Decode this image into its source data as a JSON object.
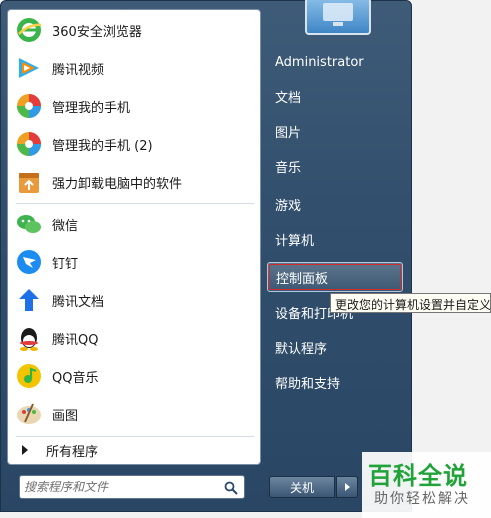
{
  "start_menu": {
    "pinned_apps": [
      {
        "label": "360安全浏览器",
        "icon": "360-browser-icon"
      },
      {
        "label": "腾讯视频",
        "icon": "tencent-video-icon"
      },
      {
        "label": "管理我的手机",
        "icon": "phone-manager-icon"
      },
      {
        "label": "管理我的手机 (2)",
        "icon": "phone-manager-icon"
      },
      {
        "label": "强力卸载电脑中的软件",
        "icon": "uninstaller-icon"
      },
      {
        "label": "微信",
        "icon": "wechat-icon"
      },
      {
        "label": "钉钉",
        "icon": "dingtalk-icon"
      },
      {
        "label": "腾讯文档",
        "icon": "tencent-docs-icon"
      },
      {
        "label": "腾讯QQ",
        "icon": "qq-icon"
      },
      {
        "label": "QQ音乐",
        "icon": "qq-music-icon"
      },
      {
        "label": "画图",
        "icon": "paint-icon"
      }
    ],
    "all_programs": "所有程序",
    "search": {
      "placeholder": "搜索程序和文件"
    },
    "right_items": [
      {
        "label": "Administrator"
      },
      {
        "label": "文档"
      },
      {
        "label": "图片"
      },
      {
        "label": "音乐"
      },
      {
        "label": "游戏"
      },
      {
        "label": "计算机"
      },
      {
        "label": "控制面板",
        "highlighted": true
      },
      {
        "label": "设备和打印机"
      },
      {
        "label": "默认程序"
      },
      {
        "label": "帮助和支持"
      }
    ],
    "shutdown_label": "关机",
    "tooltip": "更改您的计算机设置并自定义"
  },
  "watermark": {
    "title": "百科全说",
    "subtitle": "助你轻松解决"
  },
  "colors": {
    "menu_bg": "#32506d",
    "highlight_border": "#d42a2a",
    "watermark_green": "#21a33a"
  }
}
